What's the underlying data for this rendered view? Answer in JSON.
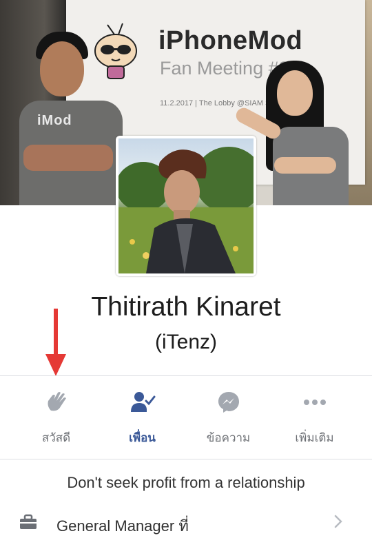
{
  "cover": {
    "banner_title": "iPhoneMod",
    "banner_subtitle": "Fan Meeting #3",
    "banner_date": "11.2.2017 | The Lobby @SIAM S",
    "shirt_text": "iMod"
  },
  "profile": {
    "name": "Thitirath Kinaret",
    "nickname": "(iTenz)"
  },
  "actions": [
    {
      "label": "สวัสดี",
      "icon": "wave-hand-icon",
      "active": false
    },
    {
      "label": "เพื่อน",
      "icon": "friends-check-icon",
      "active": true
    },
    {
      "label": "ข้อความ",
      "icon": "messenger-icon",
      "active": false
    },
    {
      "label": "เพิ่มเติม",
      "icon": "more-icon",
      "active": false
    }
  ],
  "intro": {
    "bio": "Don't seek profit from a relationship",
    "work": "General Manager ที่",
    "work_icon": "briefcase-icon"
  },
  "colors": {
    "accent": "#3b5998",
    "muted": "#8d949e",
    "annotation_arrow": "#e53935"
  }
}
